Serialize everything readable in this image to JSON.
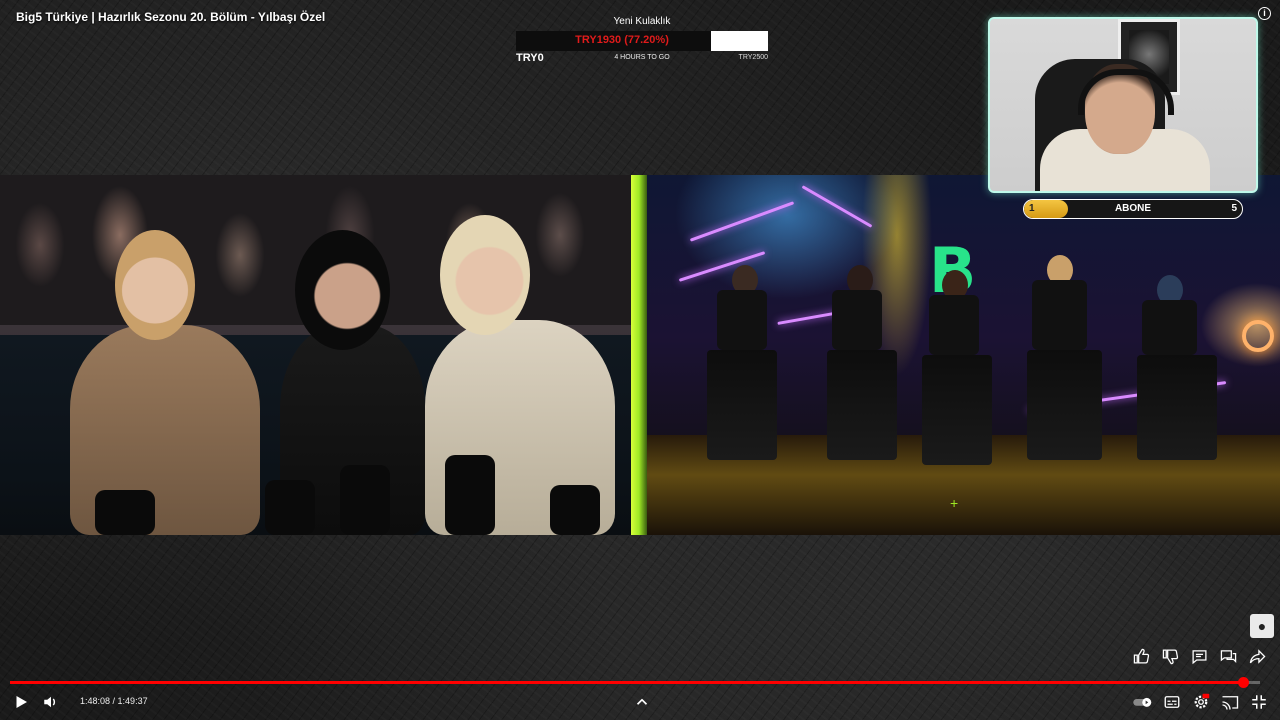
{
  "video": {
    "title": "Big5 Türkiye | Hazırlık Sezonu 20. Bölüm - Yılbaşı Özel"
  },
  "goal_widget": {
    "title": "Yeni Kulaklık",
    "current_text": "TRY1930 (77.20%)",
    "progress_fraction": 0.772,
    "start_label": "TRY0",
    "time_left": "4 HOURS TO GO",
    "target_label": "TRY2500",
    "colors": {
      "text": "#e01b1b",
      "filled": "#0d0d0d",
      "empty": "#ffffff"
    }
  },
  "abone_bar": {
    "start": "1",
    "label": "ABONE",
    "end": "5",
    "progress_fraction": 0.2,
    "fill_color": "#f4c542"
  },
  "playback": {
    "current_time": "1:48:08",
    "separator": " / ",
    "duration": "1:49:37",
    "progress_fraction": 0.9865,
    "accent_color": "#ff0000"
  },
  "icons": {
    "info": "info-icon",
    "like": "thumbs-up-icon",
    "dislike": "thumbs-down-icon",
    "comments": "comment-icon",
    "live_chat": "chat-icon",
    "share": "share-icon",
    "play": "play-icon",
    "volume": "volume-icon",
    "chevron_up": "chevron-up-icon",
    "autoplay": "autoplay-toggle-icon",
    "subtitles": "subtitles-icon",
    "settings": "settings-gear-icon",
    "cast": "cast-icon",
    "exit_fullscreen": "exit-fullscreen-icon"
  }
}
